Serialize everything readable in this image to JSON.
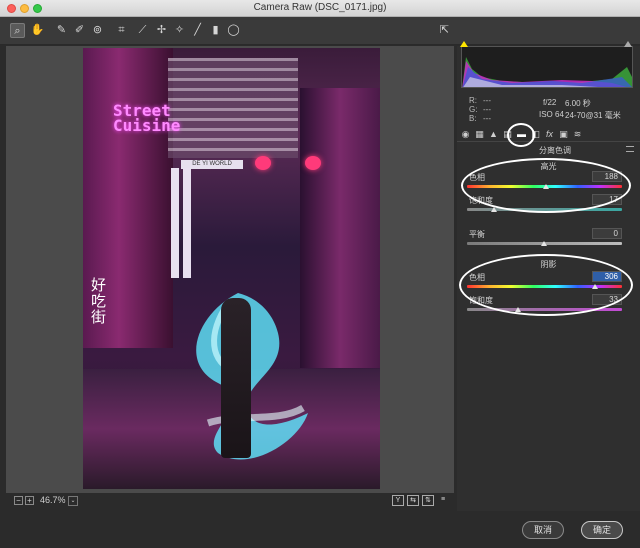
{
  "window": {
    "title": "Camera Raw (DSC_0171.jpg)"
  },
  "toolbar": {
    "tools": [
      {
        "name": "zoom-tool-icon",
        "glyph": "⌕",
        "active": true
      },
      {
        "name": "hand-tool-icon",
        "glyph": "✋",
        "active": false
      },
      {
        "name": "white-balance-tool-icon",
        "glyph": "✎",
        "active": false
      },
      {
        "name": "color-sampler-tool-icon",
        "glyph": "✐",
        "active": false
      },
      {
        "name": "targeted-adjustment-tool-icon",
        "glyph": "⊚",
        "active": false
      },
      {
        "name": "crop-tool-icon",
        "glyph": "⌗",
        "active": false
      },
      {
        "name": "straighten-tool-icon",
        "glyph": "⟋",
        "active": false
      },
      {
        "name": "spot-removal-tool-icon",
        "glyph": "✢",
        "active": false
      },
      {
        "name": "red-eye-tool-icon",
        "glyph": "✧",
        "active": false
      },
      {
        "name": "adjustment-brush-icon",
        "glyph": "╱",
        "active": false
      },
      {
        "name": "graduated-filter-icon",
        "glyph": "▮",
        "active": false
      },
      {
        "name": "radial-filter-icon",
        "glyph": "◯",
        "active": false
      },
      {
        "name": "open-preferences-icon",
        "glyph": "⇱",
        "active": false
      }
    ]
  },
  "photo": {
    "sign_text": "Street\nCuisine",
    "hanzi_text": "好吃街",
    "banner_text": "DE YI WORLD"
  },
  "bottom_bar": {
    "zoom_value": "46.7%",
    "zoom_dropdown_glyph": "⌄",
    "minus_label": "−",
    "plus_label": "+",
    "view_buttons": [
      "Y",
      "⇆",
      "⇅",
      "≡"
    ]
  },
  "histogram": {
    "clip_shadow_color": "#ffe600",
    "clip_highlight_color": "#aaaaaa"
  },
  "info": {
    "r_label": "R:",
    "g_label": "G:",
    "b_label": "B:",
    "r_value": "---",
    "g_value": "---",
    "b_value": "---",
    "aperture": "f/22",
    "shutter": "6.00 秒",
    "iso": "ISO 64",
    "lens": "24-70@31 毫米"
  },
  "panel_tabs": [
    {
      "name": "basic-tab-icon",
      "glyph": "◉"
    },
    {
      "name": "tone-curve-tab-icon",
      "glyph": "▦"
    },
    {
      "name": "detail-tab-icon",
      "glyph": "▲"
    },
    {
      "name": "hsl-tab-icon",
      "glyph": "▤"
    },
    {
      "name": "split-toning-tab-icon",
      "glyph": "▬",
      "active": true
    },
    {
      "name": "lens-corrections-tab-icon",
      "glyph": "◧"
    },
    {
      "name": "effects-tab-icon",
      "glyph": "fx"
    },
    {
      "name": "camera-calibration-tab-icon",
      "glyph": "▣"
    },
    {
      "name": "presets-tab-icon",
      "glyph": "≋"
    }
  ],
  "split_toning": {
    "panel_title": "分离色调",
    "highlights": {
      "title": "高光",
      "hue_label": "色相",
      "hue_value": "188",
      "saturation_label": "饱和度",
      "saturation_value": "17"
    },
    "balance": {
      "label": "平衡",
      "value": "0"
    },
    "shadows": {
      "title": "阴影",
      "hue_label": "色相",
      "hue_value": "306",
      "saturation_label": "饱和度",
      "saturation_value": "33"
    }
  },
  "dialog": {
    "cancel_label": "取消",
    "ok_label": "确定"
  }
}
